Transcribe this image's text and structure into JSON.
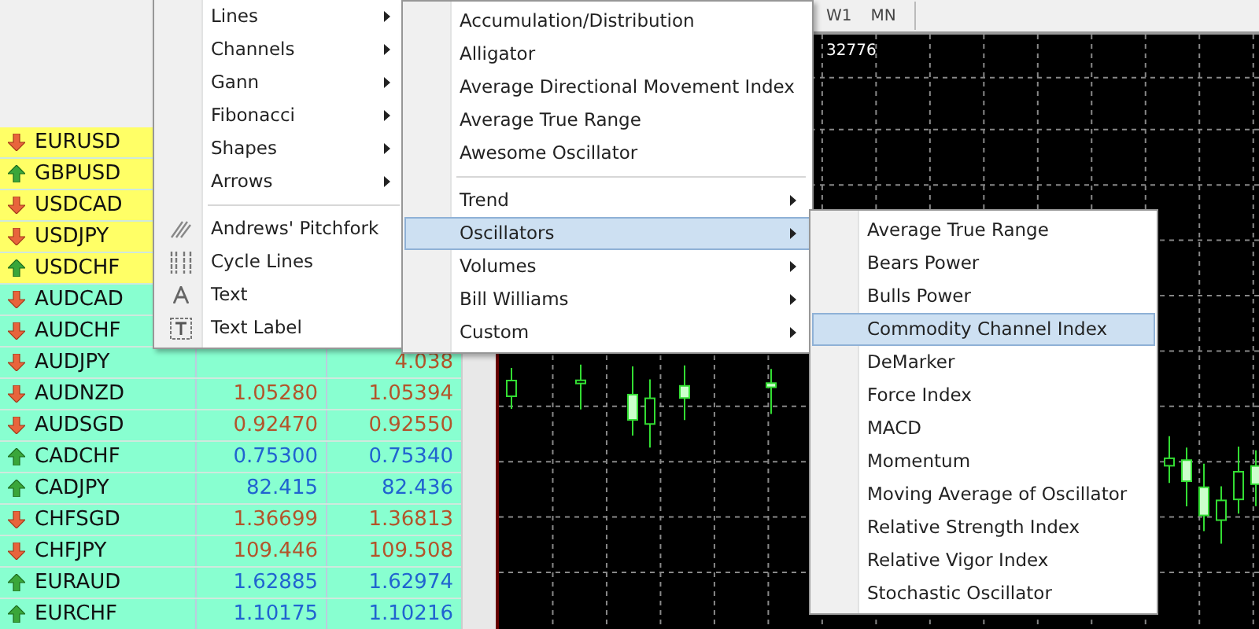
{
  "market_watch": {
    "rows": [
      {
        "symbol": "EURUSD",
        "kind": "down",
        "color": "#ffff66"
      },
      {
        "symbol": "GBPUSD",
        "kind": "up",
        "color": "#ffff66"
      },
      {
        "symbol": "USDCAD",
        "kind": "down",
        "color": "#ffff66"
      },
      {
        "symbol": "USDJPY",
        "kind": "down",
        "color": "#ffff66"
      },
      {
        "symbol": "USDCHF",
        "kind": "up",
        "color": "#ffff66"
      },
      {
        "symbol": "AUDCAD",
        "kind": "down",
        "color": "#88ffd0"
      },
      {
        "symbol": "AUDCHF",
        "kind": "down",
        "color": "#88ffd0"
      },
      {
        "symbol": "AUDJPY",
        "kind": "down",
        "color": "#88ffd0",
        "ask": "4.038"
      },
      {
        "symbol": "AUDNZD",
        "kind": "down",
        "color": "#88ffd0",
        "bid": "1.05280",
        "ask": "1.05394"
      },
      {
        "symbol": "AUDSGD",
        "kind": "down",
        "color": "#88ffd0",
        "bid": "0.92470",
        "ask": "0.92550"
      },
      {
        "symbol": "CADCHF",
        "kind": "up",
        "color": "#88ffd0",
        "bid": "0.75300",
        "ask": "0.75340"
      },
      {
        "symbol": "CADJPY",
        "kind": "up",
        "color": "#88ffd0",
        "bid": "82.415",
        "ask": "82.436"
      },
      {
        "symbol": "CHFSGD",
        "kind": "down",
        "color": "#88ffd0",
        "bid": "1.36699",
        "ask": "1.36813"
      },
      {
        "symbol": "CHFJPY",
        "kind": "down",
        "color": "#88ffd0",
        "bid": "109.446",
        "ask": "109.508"
      },
      {
        "symbol": "EURAUD",
        "kind": "up",
        "color": "#88ffd0",
        "bid": "1.62885",
        "ask": "1.62974"
      },
      {
        "symbol": "EURCHF",
        "kind": "up",
        "color": "#88ffd0",
        "bid": "1.10175",
        "ask": "1.10216"
      }
    ]
  },
  "timeframes": [
    "W1",
    "MN"
  ],
  "chart": {
    "price_label": "32776"
  },
  "objects_menu": {
    "groups": [
      [
        {
          "label": "Lines",
          "submenu": true
        },
        {
          "label": "Channels",
          "submenu": true
        },
        {
          "label": "Gann",
          "submenu": true
        },
        {
          "label": "Fibonacci",
          "submenu": true
        },
        {
          "label": "Shapes",
          "submenu": true
        },
        {
          "label": "Arrows",
          "submenu": true
        }
      ],
      [
        {
          "label": "Andrews' Pitchfork",
          "submenu": false
        },
        {
          "label": "Cycle Lines",
          "submenu": false
        },
        {
          "label": "Text",
          "submenu": false
        },
        {
          "label": "Text Label",
          "submenu": false
        }
      ]
    ]
  },
  "indicators_menu": {
    "groups": [
      [
        {
          "label": "Accumulation/Distribution",
          "submenu": false,
          "selected": false
        },
        {
          "label": "Alligator",
          "submenu": false,
          "selected": false
        },
        {
          "label": "Average Directional Movement Index",
          "submenu": false,
          "selected": false
        },
        {
          "label": "Average True Range",
          "submenu": false,
          "selected": false
        },
        {
          "label": "Awesome Oscillator",
          "submenu": false,
          "selected": false
        }
      ],
      [
        {
          "label": "Trend",
          "submenu": true,
          "selected": false
        },
        {
          "label": "Oscillators",
          "submenu": true,
          "selected": true
        },
        {
          "label": "Volumes",
          "submenu": true,
          "selected": false
        },
        {
          "label": "Bill Williams",
          "submenu": true,
          "selected": false
        },
        {
          "label": "Custom",
          "submenu": true,
          "selected": false
        }
      ]
    ]
  },
  "oscillators_menu": {
    "items": [
      {
        "label": "Average True Range",
        "selected": false
      },
      {
        "label": "Bears Power",
        "selected": false
      },
      {
        "label": "Bulls Power",
        "selected": false
      },
      {
        "label": "Commodity Channel Index",
        "selected": true
      },
      {
        "label": "DeMarker",
        "selected": false
      },
      {
        "label": "Force Index",
        "selected": false
      },
      {
        "label": "MACD",
        "selected": false
      },
      {
        "label": "Momentum",
        "selected": false
      },
      {
        "label": "Moving Average of Oscillator",
        "selected": false
      },
      {
        "label": "Relative Strength Index",
        "selected": false
      },
      {
        "label": "Relative Vigor Index",
        "selected": false
      },
      {
        "label": "Stochastic Oscillator",
        "selected": false
      }
    ]
  }
}
